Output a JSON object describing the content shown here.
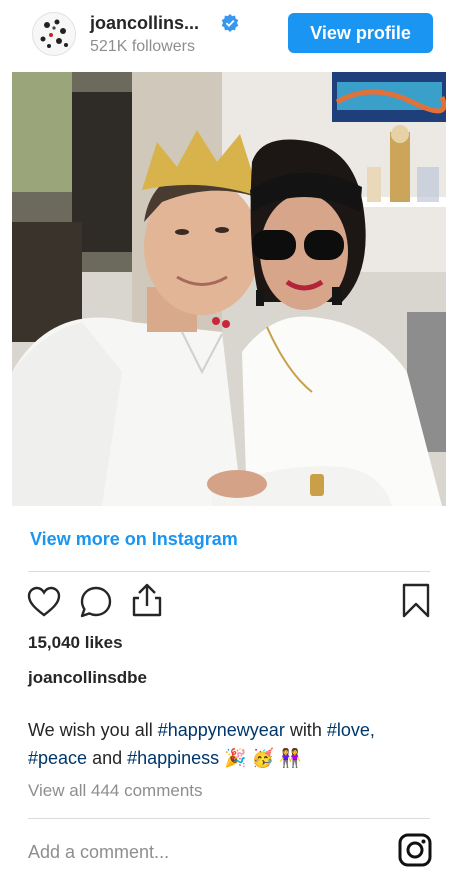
{
  "header": {
    "username": "joancollins...",
    "followers": "521K followers",
    "view_profile_label": "View profile"
  },
  "post": {
    "view_more_label": "View more on Instagram",
    "likes": "15,040 likes",
    "owner": "joancollinsdbe",
    "caption_parts": {
      "p1": "We wish you all ",
      "tag1": "#happynewyear",
      "p2": " with ",
      "tag2": "#love,",
      "tag3": "#peace",
      "p3": " and ",
      "tag4": "#happiness",
      "emoji": " 🎉 🥳 👭"
    },
    "comments_link": "View all 444 comments",
    "add_comment_placeholder": "Add a comment..."
  },
  "colors": {
    "accent": "#1a95f1",
    "hashtag": "#00376b",
    "muted": "#8e8e8e"
  },
  "icons": [
    "verified-badge-icon",
    "heart-icon",
    "comment-icon",
    "share-icon",
    "bookmark-icon",
    "instagram-icon"
  ]
}
